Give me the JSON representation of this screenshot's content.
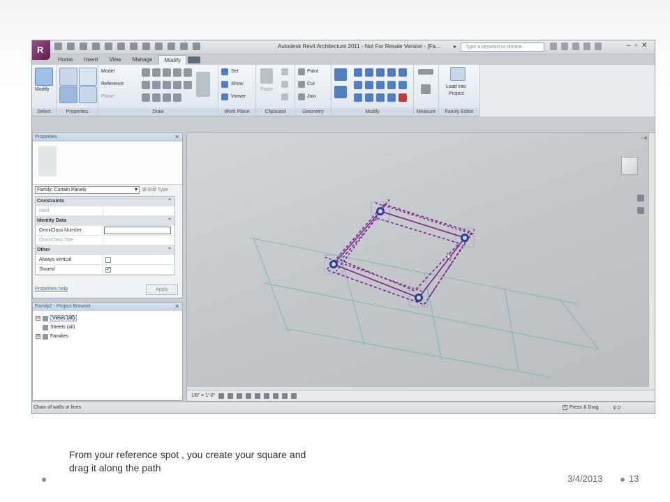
{
  "window": {
    "title": "Autodesk Revit Architecture 2011 - Not For Resale Version - [Fa...",
    "search_placeholder": "Type a keyword or phrase",
    "window_controls": [
      "–",
      "▫",
      "✕"
    ]
  },
  "tabs": [
    {
      "label": "Home"
    },
    {
      "label": "Insert"
    },
    {
      "label": "View"
    },
    {
      "label": "Manage"
    },
    {
      "label": "Modify",
      "active": true
    }
  ],
  "ribbon": {
    "select": {
      "button": "Modify",
      "panel": "Select"
    },
    "properties": {
      "panel": "Properties"
    },
    "model": {
      "model": "Model",
      "reference": "Reference",
      "plane": "Plane"
    },
    "draw": {
      "panel": "Draw"
    },
    "work_plane": {
      "set": "Set",
      "show": "Show",
      "viewer": "Viewer",
      "panel": "Work Plane"
    },
    "clipboard": {
      "paste": "Paste",
      "panel": "Clipboard"
    },
    "geometry": {
      "paint": "Paint",
      "cut": "Cut",
      "join": "Join",
      "panel": "Geometry"
    },
    "modify": {
      "panel": "Modify"
    },
    "measure": {
      "panel": "Measure"
    },
    "family_editor": {
      "load1": "Load into",
      "load2": "Project",
      "panel": "Family Editor"
    }
  },
  "properties": {
    "title": "Properties",
    "family_select": "Family: Curtain Panels",
    "edit_type": "Edit Type",
    "rows": [
      {
        "group": "Constraints"
      },
      {
        "name": "Host",
        "dim": true
      },
      {
        "group": "Identity Data"
      },
      {
        "name": "OmniClass Number",
        "input": true
      },
      {
        "name": "OmniClass Title",
        "dim": true
      },
      {
        "group": "Other"
      },
      {
        "name": "Always vertical",
        "check": ""
      },
      {
        "name": "Shared",
        "check": "✓"
      }
    ],
    "help": "Properties help",
    "apply": "Apply"
  },
  "project_browser": {
    "title": "Family2 - Project Browser",
    "items": [
      {
        "label": "Views (all)",
        "level": 0,
        "toggle": "⊟",
        "selected": true
      },
      {
        "label": "Sheets (all)",
        "level": 1
      },
      {
        "label": "Families",
        "level": 0,
        "toggle": "⊞"
      }
    ]
  },
  "view": {
    "scale": "1/8\" = 1'-0\""
  },
  "status": {
    "text": "Chain of walls or lines",
    "press_drag": "Press & Drag",
    "filter_count": ":0"
  },
  "slide": {
    "caption": "From your reference spot , you create your square and drag it along the path",
    "date": "3/4/2013",
    "page": "13"
  },
  "colors": {
    "accent": "#5b1f4e",
    "sketch": "#7a1f8a",
    "point": "#2c3e8c",
    "grid": "#6ab3b6"
  }
}
